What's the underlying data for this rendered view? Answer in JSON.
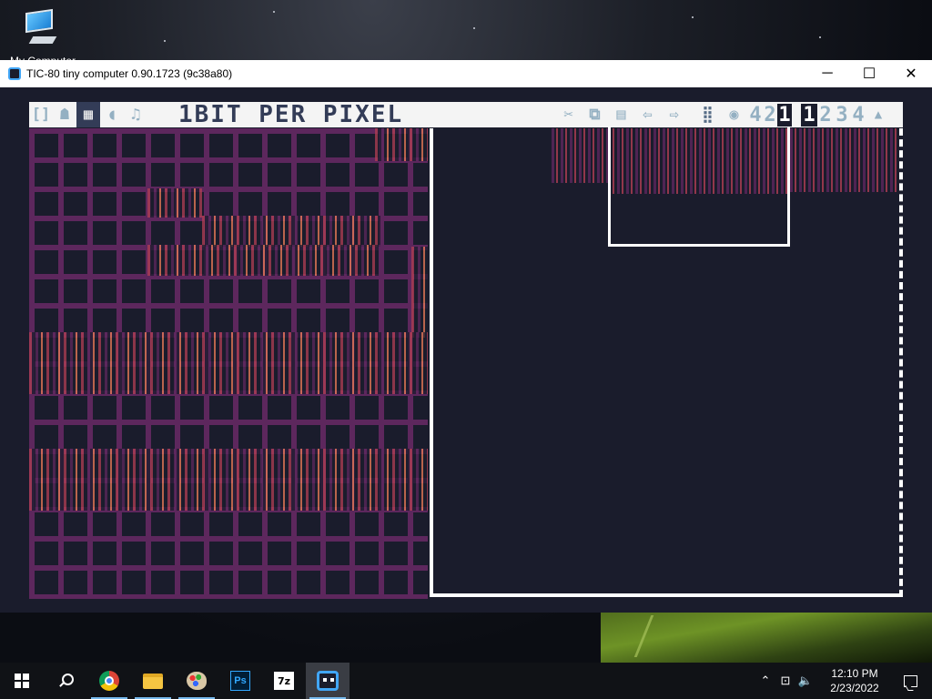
{
  "desktop": {
    "icon_label": "My Computer"
  },
  "window": {
    "title": "TIC-80 tiny computer 0.90.1723 (9c38a80)",
    "controls": {
      "minimize": "─",
      "maximize": "☐",
      "close": "✕"
    }
  },
  "tic80": {
    "tabs": [
      {
        "name": "code",
        "glyph": "[]"
      },
      {
        "name": "sprites",
        "glyph": "☗"
      },
      {
        "name": "map",
        "glyph": "▦"
      },
      {
        "name": "sfx",
        "glyph": "◖"
      },
      {
        "name": "music",
        "glyph": "♫"
      }
    ],
    "active_tab": "map",
    "mode_title": "1BIT PER PIXEL",
    "tools": [
      {
        "name": "cut",
        "glyph": "✂"
      },
      {
        "name": "copy",
        "glyph": "⧉"
      },
      {
        "name": "paste",
        "glyph": "▤"
      },
      {
        "name": "undo",
        "glyph": "⇦"
      },
      {
        "name": "redo",
        "glyph": "⇨"
      },
      {
        "name": "grid",
        "glyph": "⣿"
      },
      {
        "name": "sheet",
        "glyph": "◉"
      }
    ],
    "bpp_options": [
      "4",
      "2",
      "1"
    ],
    "bpp_selected": "1",
    "banks": [
      "1",
      "2",
      "3",
      "4"
    ],
    "bank_selected": "1",
    "scroll_glyph": "▲"
  },
  "taskbar": {
    "start_icon": "windows-logo",
    "apps": [
      "search",
      "chrome",
      "file-explorer",
      "paint",
      "photoshop",
      "7zip",
      "tic80"
    ],
    "ps_label": "Ps",
    "sevenz_label": "7z",
    "tray": {
      "chevron": "⌃",
      "network": "⊡",
      "volume": "🔈",
      "time": "12:10 PM",
      "date": "2/23/2022"
    }
  },
  "colors": {
    "tic_bg": "#1a1c2c",
    "grid": "#5d275d",
    "accent_red": "#b13e53",
    "accent_orange": "#ef7d57",
    "toolbar_bg": "#f4f4f4",
    "icon_dark": "#333c57"
  }
}
